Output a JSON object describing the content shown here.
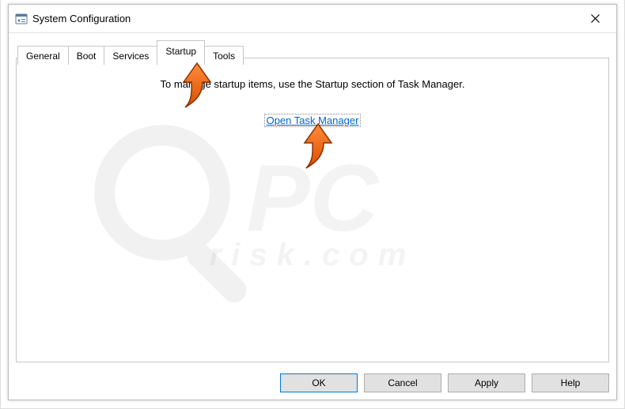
{
  "window": {
    "title": "System Configuration"
  },
  "tabs": {
    "general": "General",
    "boot": "Boot",
    "services": "Services",
    "startup": "Startup",
    "tools": "Tools",
    "active": "Startup"
  },
  "content": {
    "instruction": "To manage startup items, use the Startup section of Task Manager.",
    "link_label": "Open Task Manager"
  },
  "buttons": {
    "ok": "OK",
    "cancel": "Cancel",
    "apply": "Apply",
    "help": "Help"
  },
  "watermark": {
    "line1": "PC",
    "line2": "risk.com"
  }
}
